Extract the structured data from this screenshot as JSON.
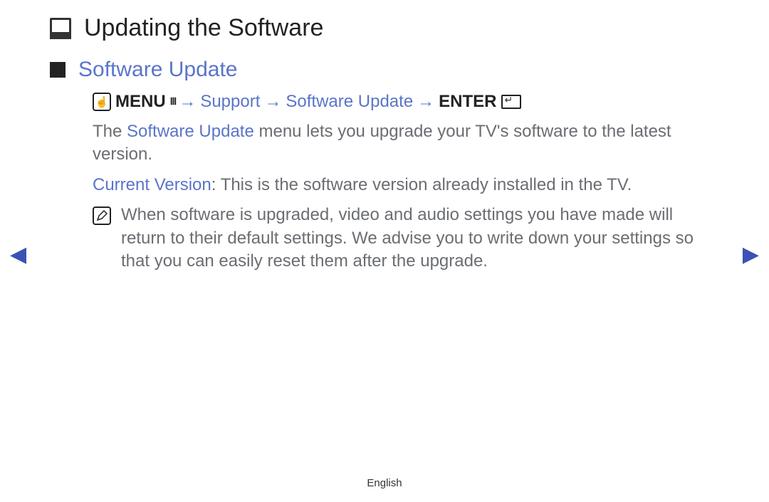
{
  "title": "Updating the Software",
  "section_title": "Software Update",
  "path": {
    "menu_label": "MENU",
    "arrow": "→",
    "support": "Support",
    "software_update": "Software Update",
    "enter_label": "ENTER"
  },
  "para1_prefix": "The ",
  "para1_highlight": "Software Update",
  "para1_suffix": " menu lets you upgrade your TV's software to the latest version.",
  "current_version_label": "Current Version",
  "current_version_text": ": This is the software version already installed in the TV.",
  "note_text": "When software is upgraded, video and audio settings you have made will return to their default settings. We advise you to write down your settings so that you can easily reset them after the upgrade.",
  "footer": "English",
  "nav_left_glyph": "◀",
  "nav_right_glyph": "▶"
}
